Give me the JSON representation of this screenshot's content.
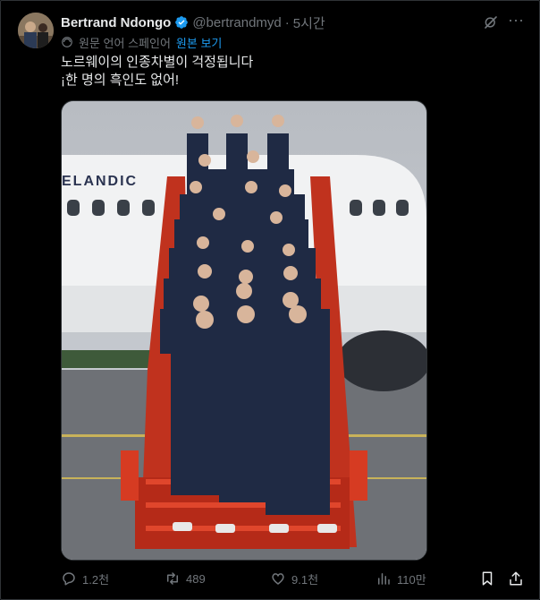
{
  "author": {
    "name": "Bertrand Ndongo",
    "handle": "@bertrandmyd",
    "separator": "·",
    "time": "5시간"
  },
  "translation": {
    "info": "원문 언어 스페인어",
    "show_original": "원본 보기"
  },
  "tweet": {
    "line1": "노르웨이의 인종차별이 걱정됩니다",
    "line2": "¡한 명의 흑인도 없어!"
  },
  "media": {
    "plane_text": "ELANDIC",
    "alt": "Norway national football team posing on airplane boarding stairs"
  },
  "actions": {
    "replies": "1.2천",
    "retweets": "489",
    "likes": "9.1천",
    "views": "110만"
  },
  "colors": {
    "accent": "#1d9bf0",
    "muted": "#71767b",
    "text": "#e7e9ea",
    "background": "#000000"
  },
  "icons": {
    "verified": "verified-badge-icon",
    "grok": "grok-icon",
    "more": "more-icon",
    "globe": "globe-icon",
    "reply": "reply-icon",
    "retweet": "retweet-icon",
    "like": "heart-icon",
    "views": "views-icon",
    "bookmark": "bookmark-icon",
    "share": "share-icon"
  }
}
